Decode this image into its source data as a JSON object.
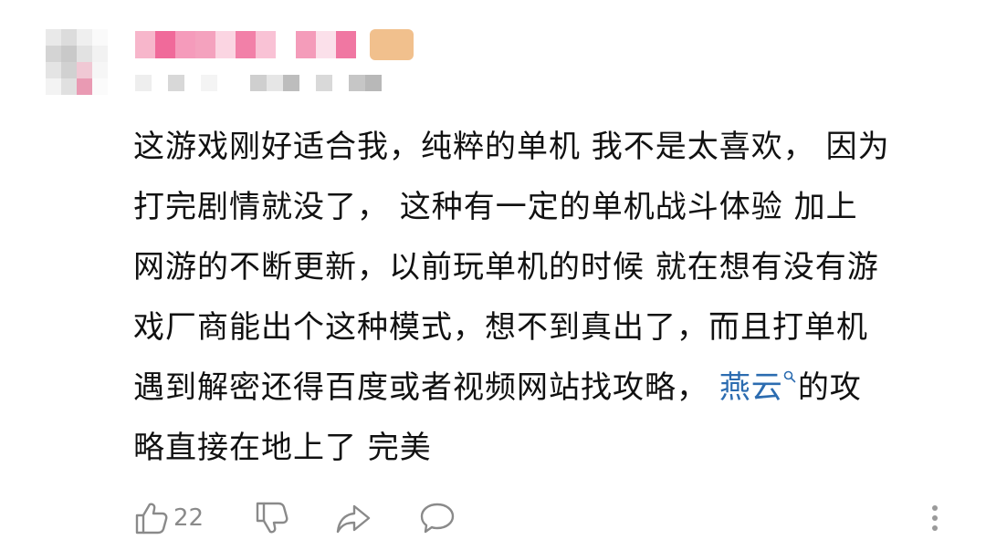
{
  "comment": {
    "lines": [
      "这游戏刚好适合我，纯粹的单机 我不是太喜欢， 因为",
      "打完剧情就没了， 这种有一定的单机战斗体验  加上",
      "网游的不断更新，以前玩单机的时候 就在想有没有游",
      "戏厂商能出个这种模式，想不到真出了，而且打单机"
    ],
    "line5_before": "遇到解密还得百度或者视频网站找攻略， ",
    "line5_link": "燕云",
    "line5_after": "的攻",
    "line6": "略直接在地上了  完美"
  },
  "actions": {
    "like_count": "22"
  },
  "icons": {
    "like": "thumbs-up-icon",
    "dislike": "thumbs-down-icon",
    "share": "share-icon",
    "reply": "comment-icon",
    "more": "more-vertical-icon",
    "link_search": "search-icon"
  },
  "colors": {
    "link": "#2c6cb0",
    "icon": "#8a8a8a",
    "text": "#111111"
  }
}
